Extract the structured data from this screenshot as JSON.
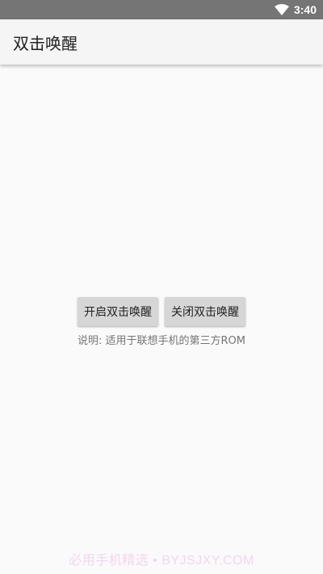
{
  "status_bar": {
    "time": "3:40",
    "icons": [
      "wifi-icon"
    ]
  },
  "app_bar": {
    "title": "双击唤醒"
  },
  "buttons": {
    "enable_label": "开启双击唤醒",
    "disable_label": "关闭双击唤醒"
  },
  "note": {
    "text": "说明: 适用于联想手机的第三方ROM"
  },
  "watermark": {
    "text": "必用手机精选 • BYJSJXY.COM"
  },
  "colors": {
    "status_bar_bg": "#757575",
    "app_bar_bg": "#f5f5f5",
    "background": "#fafafa",
    "button_bg": "#d6d6d6"
  }
}
